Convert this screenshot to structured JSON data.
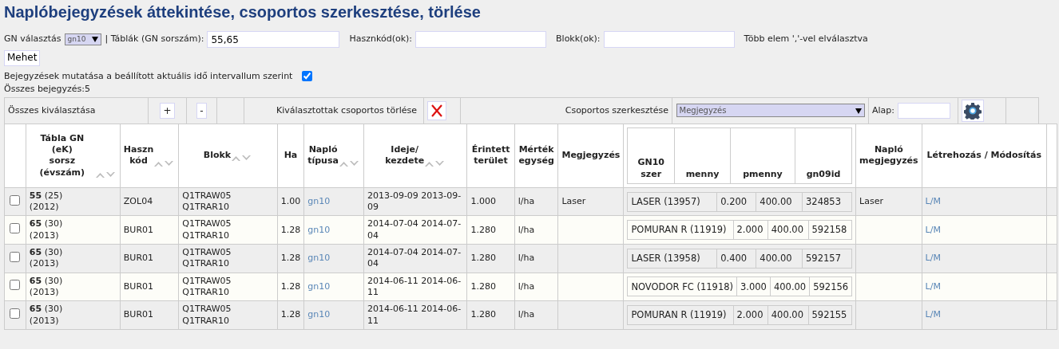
{
  "title": "Naplóbejegyzések áttekintése, csoportos szerkesztése, törlése",
  "filter": {
    "gn_label": "GN választás",
    "gn_select": "gn10",
    "tables_label": "| Táblák (GN sorszám):",
    "tables_value": "55,65",
    "hasznkod_label": "Hasznkód(ok):",
    "blokk_label": "Blokk(ok):",
    "hint": "Több elem ','-vel elválasztva",
    "go_button": "Mehet"
  },
  "time_filter": {
    "label": "Bejegyzések mutatása a beállított aktuális idő intervallum szerint",
    "checked": true
  },
  "total": "Összes bejegyzés:5",
  "toolbar": {
    "select_all": "Összes kiválasztása",
    "plus": "+",
    "minus": "-",
    "delete_label": "Kiválasztottak csoportos törlése",
    "group_edit_label": "Csoportos szerkesztése",
    "group_edit_select": "Megjegyzés",
    "alap_label": "Alap:"
  },
  "columns": [
    {
      "label": "Tábla GN (eK)\nsorsz\n(évszám)",
      "sortable": true
    },
    {
      "label": "Haszn\nkód",
      "sortable": true
    },
    {
      "label": "Blokk",
      "sortable": true
    },
    {
      "label": "Ha",
      "sortable": false
    },
    {
      "label": "Napló\ntípusa",
      "sortable": true
    },
    {
      "label": "Ideje/\nkezdete",
      "sortable": true
    },
    {
      "label": "Érintett\nterület",
      "sortable": false
    },
    {
      "label": "Mérték\negység",
      "sortable": false
    },
    {
      "label": "Megjegyzés",
      "sortable": false
    },
    {
      "label": "Napló\nmegjegyzés",
      "sortable": false
    },
    {
      "label": "Létrehozás / Módosítás",
      "sortable": false
    }
  ],
  "gn10_columns": [
    "GN10\nszer",
    "menny",
    "pmenny",
    "gn09id"
  ],
  "rows": [
    {
      "checked": false,
      "num": "55",
      "ek": "(25)",
      "year": "(2012)",
      "haszn": "ZOL04",
      "blokk": "Q1TRAW05\nQ1TRAR10",
      "ha": "1.00",
      "type": "gn10",
      "date": "2013-09-09 2013-09-09",
      "area": "1.000",
      "unit": "l/ha",
      "note": "Laser",
      "item": {
        "szer": "LASER (13957)",
        "menny": "0.200",
        "pmenny": "400.00",
        "gn09id": "324853"
      },
      "log_note": "Laser",
      "action": "L/M"
    },
    {
      "checked": false,
      "num": "65",
      "ek": "(30)",
      "year": "(2013)",
      "haszn": "BUR01",
      "blokk": "Q1TRAW05\nQ1TRAR10",
      "ha": "1.28",
      "type": "gn10",
      "date": "2014-07-04 2014-07-04",
      "area": "1.280",
      "unit": "l/ha",
      "item": {
        "szer": "POMURAN R (11919)",
        "menny": "2.000",
        "pmenny": "400.00",
        "gn09id": "592158"
      },
      "action": "L/M"
    },
    {
      "checked": false,
      "num": "65",
      "ek": "(30)",
      "year": "(2013)",
      "haszn": "BUR01",
      "blokk": "Q1TRAW05\nQ1TRAR10",
      "ha": "1.28",
      "type": "gn10",
      "date": "2014-07-04 2014-07-04",
      "area": "1.280",
      "unit": "l/ha",
      "item": {
        "szer": "LASER (13958)",
        "menny": "0.400",
        "pmenny": "400.00",
        "gn09id": "592157"
      },
      "action": "L/M"
    },
    {
      "checked": false,
      "num": "65",
      "ek": "(30)",
      "year": "(2013)",
      "haszn": "BUR01",
      "blokk": "Q1TRAW05\nQ1TRAR10",
      "ha": "1.28",
      "type": "gn10",
      "date": "2014-06-11 2014-06-11",
      "area": "1.280",
      "unit": "l/ha",
      "item": {
        "szer": "NOVODOR FC (11918)",
        "menny": "3.000",
        "pmenny": "400.00",
        "gn09id": "592156"
      },
      "action": "L/M"
    },
    {
      "checked": false,
      "num": "65",
      "ek": "(30)",
      "year": "(2013)",
      "haszn": "BUR01",
      "blokk": "Q1TRAW05\nQ1TRAR10",
      "ha": "1.28",
      "type": "gn10",
      "date": "2014-06-11 2014-06-11",
      "area": "1.280",
      "unit": "l/ha",
      "item": {
        "szer": "POMURAN R (11919)",
        "menny": "2.000",
        "pmenny": "400.00",
        "gn09id": "592155"
      },
      "action": "L/M"
    }
  ]
}
